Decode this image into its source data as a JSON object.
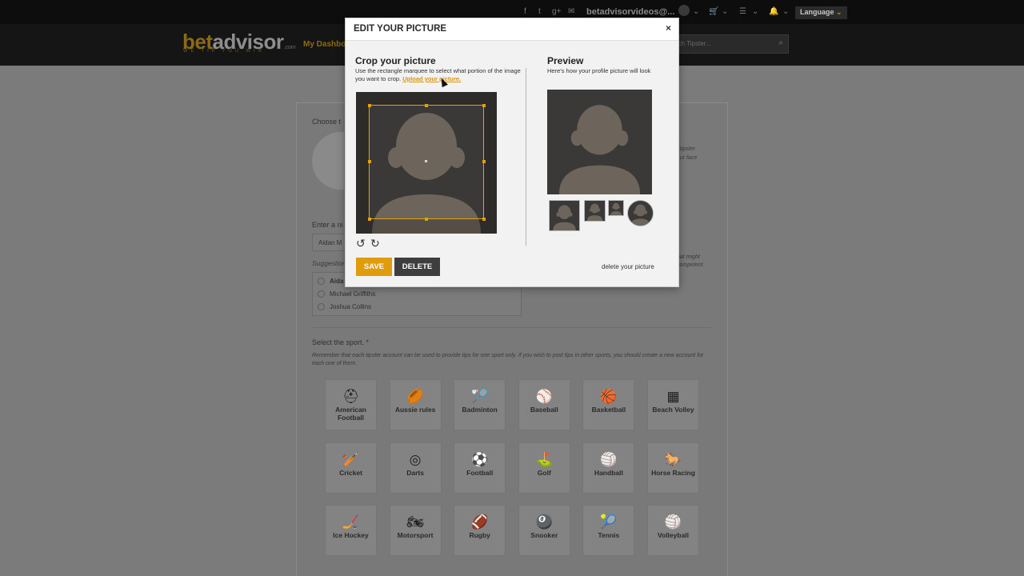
{
  "topbar": {
    "social_icons": [
      "f",
      "t",
      "g+",
      "✉"
    ],
    "email": "betadvisorvideos@...",
    "language": "Language",
    "cart_icon": "🛒",
    "settings_icon": "☰",
    "bell_icon": "🔔"
  },
  "navbar": {
    "logo_bet": "bet",
    "logo_advisor": "advisor",
    "logo_com": ".com",
    "tagline": "WE TIP YOU WIN",
    "dashboard_link": "My Dashboa",
    "search_placeholder": "rch Tipster..."
  },
  "background_form": {
    "choose_label": "Choose t",
    "right_hint_1": "tipster",
    "right_hint_2": "ur face",
    "enter_label": "Enter a ni",
    "name_value": "Aidan M",
    "suggestions_label": "Suggestion",
    "suggestions": [
      "Aida",
      "Michael Griffiths",
      "Joshua Collins"
    ],
    "right_hint_3": "hat might",
    "right_hint_4": "competent",
    "sport_title": "Select the sport. *",
    "sport_desc": "Remember that each tipster account can be used to provide tips for one sport only. If you wish to post tips in other sports, you should create a new account for each one of them.",
    "sports": [
      {
        "label": "American Football",
        "icon": "⛑"
      },
      {
        "label": "Aussie rules",
        "icon": "🏉"
      },
      {
        "label": "Badminton",
        "icon": "🏸"
      },
      {
        "label": "Baseball",
        "icon": "⚾"
      },
      {
        "label": "Basketball",
        "icon": "🏀"
      },
      {
        "label": "Beach Volley",
        "icon": "▦"
      },
      {
        "label": "Cricket",
        "icon": "🏏"
      },
      {
        "label": "Darts",
        "icon": "◎"
      },
      {
        "label": "Football",
        "icon": "⚽"
      },
      {
        "label": "Golf",
        "icon": "⛳"
      },
      {
        "label": "Handball",
        "icon": "🏐"
      },
      {
        "label": "Horse Racing",
        "icon": "🐎"
      },
      {
        "label": "Ice Hockey",
        "icon": "🏒"
      },
      {
        "label": "Motorsport",
        "icon": "🏍"
      },
      {
        "label": "Rugby",
        "icon": "🏈"
      },
      {
        "label": "Snooker",
        "icon": "🎱"
      },
      {
        "label": "Tennis",
        "icon": "🎾"
      },
      {
        "label": "Volleyball",
        "icon": "🏐"
      }
    ]
  },
  "modal": {
    "title": "EDIT YOUR PICTURE",
    "close": "×",
    "crop_heading": "Crop your picture",
    "crop_desc": "Use the rectangle marquee to select what portion of the image you want to crop.",
    "upload_link": "Upload your picture.",
    "rotate_left": "↺",
    "rotate_right": "↻",
    "preview_heading": "Preview",
    "preview_desc": "Here's how your profile picture will look",
    "save": "SAVE",
    "delete": "DELETE",
    "delete_link": "delete your picture",
    "avatar_bg": "#3a3938",
    "avatar_fg": "#6d655c",
    "accent": "#e09c0d"
  }
}
